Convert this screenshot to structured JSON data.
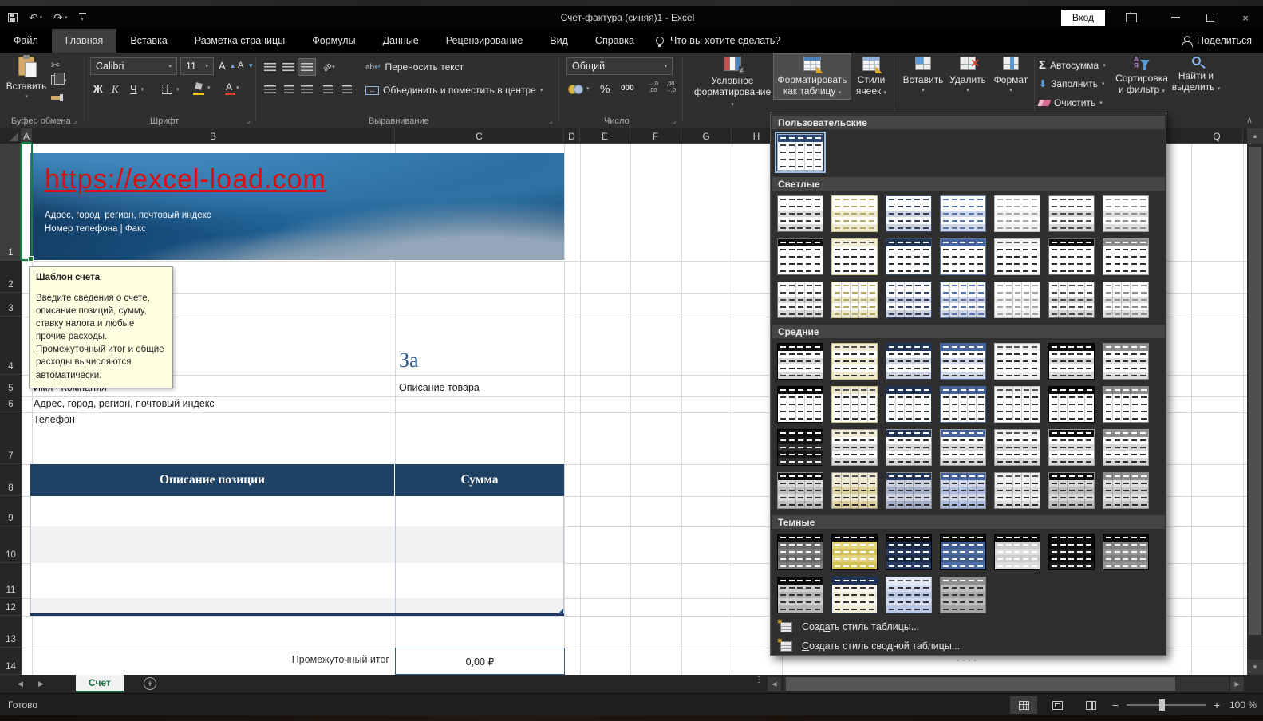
{
  "window": {
    "title": "Счет-фактура (синяя)1  -  Excel",
    "sign_in": "Вход"
  },
  "ribbon_tabs": {
    "items": [
      "Файл",
      "Главная",
      "Вставка",
      "Разметка страницы",
      "Формулы",
      "Данные",
      "Рецензирование",
      "Вид",
      "Справка"
    ],
    "active": "Главная",
    "tell_me": "Что вы хотите сделать?",
    "share": "Поделиться"
  },
  "ribbon": {
    "clipboard": {
      "paste": "Вставить",
      "group": "Буфер обмена"
    },
    "font": {
      "name": "Calibri",
      "size": "11",
      "bold": "Ж",
      "italic": "К",
      "underline": "Ч",
      "group": "Шрифт"
    },
    "alignment": {
      "wrap": "Переносить текст",
      "merge": "Объединить и поместить в центре",
      "group": "Выравнивание"
    },
    "number": {
      "format": "Общий",
      "zeros": "000",
      "percent": "%",
      "group": "Число"
    },
    "styles": {
      "conditional_1": "Условное",
      "conditional_2": "форматирование",
      "format_table_1": "Форматировать",
      "format_table_2": "как таблицу",
      "cell_styles_1": "Стили",
      "cell_styles_2": "ячеек"
    },
    "cells": {
      "insert": "Вставить",
      "delete": "Удалить",
      "format": "Формат"
    },
    "editing": {
      "autosum": "Автосумма",
      "fill": "Заполнить",
      "clear": "Очистить",
      "sort_1": "Сортировка",
      "sort_2": "и фильтр",
      "find_1": "Найти и",
      "find_2": "выделить"
    }
  },
  "gallery": {
    "new_table_style": {
      "pre": "Созд",
      "u": "а",
      "post": "ть стиль таблицы..."
    },
    "new_pivot_style": {
      "pre": "",
      "u": "С",
      "post": "оздать стиль сводной таблицы..."
    },
    "sections": [
      {
        "title": "Пользовательские",
        "rows": [
          [
            {
              "h": "#2b4a79",
              "hd": "#ffffff",
              "b": "#ffffff",
              "s": "#ffffff",
              "d": "#3a3a3a",
              "bd": "#9db4d6",
              "g": 1,
              "sel": 1
            }
          ]
        ]
      },
      {
        "title": "Светлые",
        "rows": [
          [
            {
              "h": "#ffffff",
              "hd": "#3a3a3a",
              "b": "#ffffff",
              "s": "#d9d9d9",
              "d": "#3a3a3a",
              "bd": "#6a6a6a"
            },
            {
              "h": "#ffffff",
              "hd": "#b3a964",
              "b": "#ffffff",
              "s": "#efe9cf",
              "d": "#b3a964",
              "bd": "#cdc68e"
            },
            {
              "h": "#ffffff",
              "hd": "#33415e",
              "b": "#ffffff",
              "s": "#ccd2df",
              "d": "#33415e",
              "bd": "#33466b"
            },
            {
              "h": "#ffffff",
              "hd": "#5673a9",
              "b": "#ffffff",
              "s": "#cfd7e9",
              "d": "#5673a9",
              "bd": "#6079ab"
            },
            {
              "h": "#ffffff",
              "hd": "#a6a6a6",
              "b": "#ffffff",
              "s": "#f1f1f1",
              "d": "#a6a6a6",
              "bd": "#c2c2c2"
            },
            {
              "h": "#ffffff",
              "hd": "#4a4a4a",
              "b": "#ffffff",
              "s": "#d6d6d6",
              "d": "#4a4a4a",
              "bd": "#6a6a6a"
            },
            {
              "h": "#ffffff",
              "hd": "#8e8e8e",
              "b": "#ffffff",
              "s": "#dfdfdf",
              "d": "#8e8e8e",
              "bd": "#a0a0a0"
            }
          ],
          [
            {
              "h": "#0d0d0d",
              "hd": "#ffffff",
              "b": "#ffffff",
              "s": "#ffffff",
              "d": "#2e2e2e",
              "bd": "#6a6a6a"
            },
            {
              "h": "#f2ecd4",
              "hd": "#555555",
              "b": "#ffffff",
              "s": "#ffffff",
              "d": "#2e2e2e",
              "bd": "#cdc68e"
            },
            {
              "h": "#203456",
              "hd": "#ffffff",
              "b": "#ffffff",
              "s": "#ffffff",
              "d": "#2e2e2e",
              "bd": "#33466b"
            },
            {
              "h": "#47639d",
              "hd": "#ffffff",
              "b": "#ffffff",
              "s": "#ffffff",
              "d": "#2e2e2e",
              "bd": "#6079ab"
            },
            {
              "h": "#f0f0f0",
              "hd": "#555555",
              "b": "#ffffff",
              "s": "#ffffff",
              "d": "#2e2e2e",
              "bd": "#c2c2c2"
            },
            {
              "h": "#0d0d0d",
              "hd": "#ffffff",
              "b": "#ffffff",
              "s": "#ffffff",
              "d": "#2e2e2e",
              "bd": "#6a6a6a"
            },
            {
              "h": "#8c8c8c",
              "hd": "#ffffff",
              "b": "#ffffff",
              "s": "#ffffff",
              "d": "#2e2e2e",
              "bd": "#a0a0a0"
            }
          ],
          [
            {
              "h": "#ffffff",
              "hd": "#3a3a3a",
              "b": "#ffffff",
              "s": "#d9d9d9",
              "d": "#3a3a3a",
              "bd": "#6a6a6a",
              "g": 1
            },
            {
              "h": "#ffffff",
              "hd": "#b3a964",
              "b": "#ffffff",
              "s": "#efe9cf",
              "d": "#b3a964",
              "bd": "#cdc68e",
              "g": 1
            },
            {
              "h": "#ffffff",
              "hd": "#33415e",
              "b": "#ffffff",
              "s": "#ccd2df",
              "d": "#33415e",
              "bd": "#33466b",
              "g": 1
            },
            {
              "h": "#ffffff",
              "hd": "#5673a9",
              "b": "#ffffff",
              "s": "#cfd7e9",
              "d": "#5673a9",
              "bd": "#6079ab",
              "g": 1
            },
            {
              "h": "#ffffff",
              "hd": "#a6a6a6",
              "b": "#ffffff",
              "s": "#f1f1f1",
              "d": "#a6a6a6",
              "bd": "#c2c2c2",
              "g": 1
            },
            {
              "h": "#ffffff",
              "hd": "#4a4a4a",
              "b": "#ffffff",
              "s": "#d6d6d6",
              "d": "#4a4a4a",
              "bd": "#6a6a6a",
              "g": 1
            },
            {
              "h": "#ffffff",
              "hd": "#8e8e8e",
              "b": "#ffffff",
              "s": "#dfdfdf",
              "d": "#8e8e8e",
              "bd": "#a0a0a0",
              "g": 1
            }
          ]
        ]
      },
      {
        "title": "Средние",
        "rows": [
          [
            {
              "h": "#0d0d0d",
              "hd": "#ffffff",
              "b": "#ffffff",
              "s": "#d9d9d9",
              "d": "#2e2e2e",
              "bd": "#000000"
            },
            {
              "h": "#f2ecd4",
              "hd": "#555555",
              "b": "#ffffff",
              "s": "#efe9cf",
              "d": "#2e2e2e",
              "bd": "#c9bf83"
            },
            {
              "h": "#203456",
              "hd": "#ffffff",
              "b": "#ffffff",
              "s": "#ccd2df",
              "d": "#2e2e2e",
              "bd": "#203456"
            },
            {
              "h": "#47639d",
              "hd": "#ffffff",
              "b": "#ffffff",
              "s": "#cfd7e9",
              "d": "#2e2e2e",
              "bd": "#47639d"
            },
            {
              "h": "#f0f0f0",
              "hd": "#555555",
              "b": "#ffffff",
              "s": "#f1f1f1",
              "d": "#2e2e2e",
              "bd": "#bdbdbd"
            },
            {
              "h": "#0d0d0d",
              "hd": "#ffffff",
              "b": "#ffffff",
              "s": "#d6d6d6",
              "d": "#2e2e2e",
              "bd": "#000000"
            },
            {
              "h": "#8c8c8c",
              "hd": "#ffffff",
              "b": "#ffffff",
              "s": "#dfdfdf",
              "d": "#2e2e2e",
              "bd": "#7f7f7f"
            }
          ],
          [
            {
              "h": "#0d0d0d",
              "hd": "#ffffff",
              "b": "#ffffff",
              "s": "#ffffff",
              "d": "#2e2e2e",
              "bd": "#000000",
              "g": 1
            },
            {
              "h": "#f2ecd4",
              "hd": "#555555",
              "b": "#ffffff",
              "s": "#ffffff",
              "d": "#2e2e2e",
              "bd": "#c9bf83",
              "g": 1
            },
            {
              "h": "#203456",
              "hd": "#ffffff",
              "b": "#ffffff",
              "s": "#ffffff",
              "d": "#2e2e2e",
              "bd": "#203456",
              "g": 1
            },
            {
              "h": "#47639d",
              "hd": "#ffffff",
              "b": "#ffffff",
              "s": "#ffffff",
              "d": "#2e2e2e",
              "bd": "#47639d",
              "g": 1
            },
            {
              "h": "#f0f0f0",
              "hd": "#555555",
              "b": "#ffffff",
              "s": "#ffffff",
              "d": "#2e2e2e",
              "bd": "#bdbdbd",
              "g": 1
            },
            {
              "h": "#0d0d0d",
              "hd": "#ffffff",
              "b": "#ffffff",
              "s": "#ffffff",
              "d": "#2e2e2e",
              "bd": "#000000",
              "g": 1
            },
            {
              "h": "#8c8c8c",
              "hd": "#ffffff",
              "b": "#ffffff",
              "s": "#ffffff",
              "d": "#2e2e2e",
              "bd": "#7f7f7f",
              "g": 1
            }
          ],
          [
            {
              "h": "#0d0d0d",
              "hd": "#ffffff",
              "b": "#161616",
              "s": "#2e2e2e",
              "d": "#ededed",
              "bd": "#000000",
              "g": 1
            },
            {
              "h": "#f2ecd4",
              "hd": "#555555",
              "b": "#ffffff",
              "s": "#d8d8d8",
              "d": "#2e2e2e",
              "bd": "#9a9a9a"
            },
            {
              "h": "#203456",
              "hd": "#ffffff",
              "b": "#ffffff",
              "s": "#d8d8d8",
              "d": "#2e2e2e",
              "bd": "#9a9a9a"
            },
            {
              "h": "#47639d",
              "hd": "#ffffff",
              "b": "#ffffff",
              "s": "#d8d8d8",
              "d": "#2e2e2e",
              "bd": "#9a9a9a"
            },
            {
              "h": "#f0f0f0",
              "hd": "#555555",
              "b": "#ffffff",
              "s": "#d8d8d8",
              "d": "#2e2e2e",
              "bd": "#9a9a9a"
            },
            {
              "h": "#0d0d0d",
              "hd": "#ffffff",
              "b": "#ffffff",
              "s": "#d8d8d8",
              "d": "#2e2e2e",
              "bd": "#9a9a9a"
            },
            {
              "h": "#8c8c8c",
              "hd": "#ffffff",
              "b": "#ffffff",
              "s": "#d8d8d8",
              "d": "#2e2e2e",
              "bd": "#9a9a9a"
            }
          ],
          [
            {
              "h": "#0d0d0d",
              "hd": "#ffffff",
              "b": "#d9d9d9",
              "s": "#bfbfbf",
              "d": "#2e2e2e",
              "bd": "#8a8a8a",
              "g": 1
            },
            {
              "h": "#f2ecd4",
              "hd": "#555555",
              "b": "#efe9cf",
              "s": "#ded2a0",
              "d": "#2e2e2e",
              "bd": "#8a8a8a",
              "g": 1
            },
            {
              "h": "#203456",
              "hd": "#ffffff",
              "b": "#ccd2df",
              "s": "#a5b1cb",
              "d": "#2e2e2e",
              "bd": "#8a8a8a",
              "g": 1
            },
            {
              "h": "#47639d",
              "hd": "#ffffff",
              "b": "#cfd7e9",
              "s": "#b0bfe0",
              "d": "#2e2e2e",
              "bd": "#8a8a8a",
              "g": 1
            },
            {
              "h": "#f0f0f0",
              "hd": "#555555",
              "b": "#f1f1f1",
              "s": "#dddddd",
              "d": "#2e2e2e",
              "bd": "#8a8a8a",
              "g": 1
            },
            {
              "h": "#0d0d0d",
              "hd": "#ffffff",
              "b": "#d6d6d6",
              "s": "#bdbdbd",
              "d": "#2e2e2e",
              "bd": "#8a8a8a",
              "g": 1
            },
            {
              "h": "#8c8c8c",
              "hd": "#ffffff",
              "b": "#dfdfdf",
              "s": "#c9c9c9",
              "d": "#2e2e2e",
              "bd": "#8a8a8a",
              "g": 1
            }
          ]
        ]
      },
      {
        "title": "Темные",
        "rows": [
          [
            {
              "h": "#0b0b0b",
              "hd": "#ffffff",
              "b": "#686868",
              "s": "#7d7d7d",
              "d": "#f5f5f5",
              "bd": "#000000"
            },
            {
              "h": "#0b0b0b",
              "hd": "#ffffff",
              "b": "#e2d47c",
              "s": "#d2c258",
              "d": "#ffffff",
              "bd": "#000000"
            },
            {
              "h": "#0b0b0b",
              "hd": "#ffffff",
              "b": "#1a2a45",
              "s": "#253a5e",
              "d": "#f5f5f5",
              "bd": "#000000"
            },
            {
              "h": "#0b0b0b",
              "hd": "#ffffff",
              "b": "#405c8e",
              "s": "#4f6da0",
              "d": "#f5f5f5",
              "bd": "#000000"
            },
            {
              "h": "#0b0b0b",
              "hd": "#ffffff",
              "b": "#cccccc",
              "s": "#dddddd",
              "d": "#ffffff",
              "bd": "#000000"
            },
            {
              "h": "#0b0b0b",
              "hd": "#ffffff",
              "b": "#0a0a0a",
              "s": "#1c1c1c",
              "d": "#f5f5f5",
              "bd": "#000000"
            },
            {
              "h": "#0b0b0b",
              "hd": "#ffffff",
              "b": "#808080",
              "s": "#939393",
              "d": "#f5f5f5",
              "bd": "#000000"
            }
          ],
          [
            {
              "h": "#0b0b0b",
              "hd": "#ffffff",
              "b": "#cdcdcd",
              "s": "#b4b4b4",
              "d": "#333333",
              "bd": "#000000"
            },
            {
              "h": "#203457",
              "hd": "#ffffff",
              "b": "#fbf8ee",
              "s": "#f1ecd8",
              "d": "#333333",
              "bd": "#203457"
            },
            {
              "h": "#e4e9f3",
              "hd": "#555566",
              "b": "#d3dcee",
              "s": "#bac7e3",
              "d": "#333344",
              "bd": "#aab6d0"
            },
            {
              "h": "#8f8f8f",
              "hd": "#ffffff",
              "b": "#bdbdbd",
              "s": "#a6a6a6",
              "d": "#333333",
              "bd": "#7f7f7f"
            }
          ]
        ]
      }
    ]
  },
  "sheet": {
    "col_headers": [
      "A",
      "B",
      "C",
      "D",
      "E",
      "F",
      "G",
      "H"
    ],
    "far_col": "Q",
    "row_headers": [
      "1",
      "2",
      "3",
      "4",
      "5",
      "6",
      "7",
      "8",
      "9",
      "10",
      "11",
      "12",
      "13",
      "14"
    ],
    "banner": {
      "url": "https://excel-load.com",
      "line1": "Адрес, город, регион, почтовый индекс",
      "line2": "Номер телефона | Факс"
    },
    "tooltip": {
      "title": "Шаблон счета",
      "body": "Введите сведения о счете, описание позиций, сумму, ставку налога и любые прочие расходы. Промежуточный итог и общие расходы вычисляются автоматически."
    },
    "fields": {
      "za": "За",
      "item_desc": "Описание товара",
      "name": "Имя | Компания",
      "address": "Адрес, город, регион, почтовый индекс",
      "phone": "Телефон"
    },
    "invoice_table": {
      "col1": "Описание позиции",
      "col2": "Сумма",
      "subtotal_label": "Промежуточный итог",
      "subtotal_value": "0,00 ₽"
    }
  },
  "tabs_bar": {
    "sheet_name": "Счет"
  },
  "status": {
    "ready": "Готово",
    "zoom": "100 %"
  },
  "colors": {
    "accent_green": "#107C41",
    "header_navy": "#1E4164",
    "link_red": "#e00b0b"
  }
}
